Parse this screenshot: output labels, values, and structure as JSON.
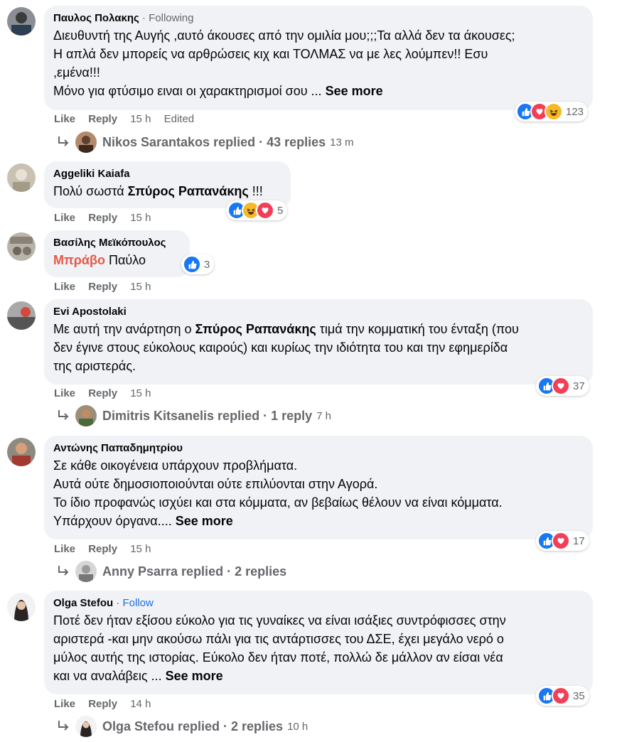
{
  "comments": [
    {
      "author": "Παυλος Πολακης",
      "relation": "Following",
      "lines": [
        "Διευθυντή της Αυγής ,αυτό άκουσες από την ομιλία μου;;;Τα αλλά δεν τα άκουσες;",
        "Η απλά δεν μπορείς να αρθρώσεις κιχ και ΤΟΛΜΑΣ να με λες λούμπεν!! Εσυ",
        ",εμένα!!!",
        "Μόνο για φτύσιμο ειναι οι χαρακτηρισμοί σου ..."
      ],
      "see_more": "See more",
      "like": "Like",
      "reply": "Reply",
      "time": "15 h",
      "edited": "Edited",
      "reaction_count": "123",
      "reactions": [
        "like",
        "love",
        "haha"
      ],
      "replies": {
        "name": "Nikos Sarantakos replied · 43 replies",
        "time": "13 m"
      }
    },
    {
      "author": "Aggeliki Kaiafa",
      "body_pre": "Πολύ σωστά ",
      "body_bold": "Σπύρος Ραπανάκης",
      "body_post": " !!!",
      "like": "Like",
      "reply": "Reply",
      "time": "15 h",
      "reaction_count": "5",
      "reactions": [
        "like",
        "haha",
        "love"
      ]
    },
    {
      "author": "Βασίλης Μεϊκόπουλος",
      "body_orange": "Μπράβο",
      "body_post": " Παύλο",
      "like": "Like",
      "reply": "Reply",
      "time": "15 h",
      "reaction_count": "3",
      "reactions": [
        "like"
      ]
    },
    {
      "author": "Evi Apostolaki",
      "l1_pre": "Με αυτή την ανάρτηση ο ",
      "l1_bold": "Σπύρος Ραπανάκης",
      "l1_post": " τιμά την κομματική του ένταξη (που",
      "l2": "δεν έγινε στους εύκολους καιρούς) και κυρίως την ιδιότητα του και την εφημερίδα",
      "l3": "της αριστεράς.",
      "like": "Like",
      "reply": "Reply",
      "time": "15 h",
      "reaction_count": "37",
      "reactions": [
        "like",
        "love"
      ],
      "replies": {
        "name": "Dimitris Kitsanelis replied · 1 reply",
        "time": "7 h"
      }
    },
    {
      "author": "Αντώνης Παπαδημητρίου",
      "lines": [
        "Σε κάθε οικογένεια υπάρχουν προβλήματα.",
        "Αυτά ούτε δημοσιοποιούνται ούτε επιλύονται στην Αγορά.",
        "Το ίδιο προφανώς ισχύει και στα κόμματα, αν βεβαίως θέλουν να είναι κόμματα.",
        "Υπάρχουν όργανα...."
      ],
      "see_more": "See more",
      "like": "Like",
      "reply": "Reply",
      "time": "15 h",
      "reaction_count": "17",
      "reactions": [
        "like",
        "love"
      ],
      "replies": {
        "name": "Anny Psarra replied · 2 replies",
        "time": ""
      }
    },
    {
      "author": "Olga Stefou",
      "relation": "Follow",
      "lines": [
        "Ποτέ δεν ήταν εξίσου εύκολο για τις γυναίκες να είναι ισάξιες συντρόφισσες στην",
        "αριστερά -και μην ακούσω πάλι για τις αντάρτισσες του ΔΣΕ, έχει μεγάλο νερό ο",
        "μύλος αυτής της ιστορίας. Εύκολο δεν ήταν ποτέ, πολλώ δε μάλλον αν είσαι νέα",
        "και να αναλάβεις ..."
      ],
      "see_more": "See more",
      "like": "Like",
      "reply": "Reply",
      "time": "14 h",
      "reaction_count": "35",
      "reactions": [
        "like",
        "love"
      ],
      "replies": {
        "name": "Olga Stefou replied · 2 replies",
        "time": "10 h"
      }
    }
  ]
}
